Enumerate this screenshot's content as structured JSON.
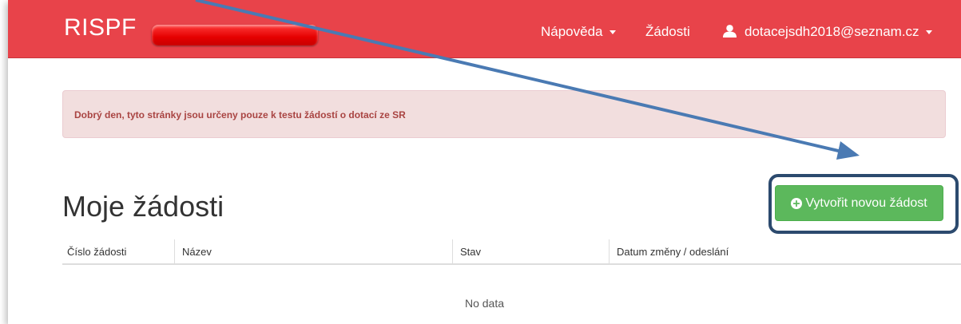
{
  "navbar": {
    "brand": "RISPF",
    "help_label": "Nápověda",
    "requests_label": "Žádosti",
    "user_email": "dotacejsdh2018@seznam.cz"
  },
  "alert": {
    "message": "Dobrý den, tyto stránky jsou určeny pouze k testu žádostí o dotací ze SR"
  },
  "page": {
    "title": "Moje žádosti",
    "create_button_label": "Vytvořit novou žádost"
  },
  "table": {
    "columns": [
      "Číslo žádosti",
      "Název",
      "Stav",
      "Datum změny / odeslání"
    ],
    "empty_text": "No data"
  },
  "colors": {
    "navbar": "#e8434a",
    "button": "#5cb85c",
    "alert_bg": "#f2dede",
    "annotation": "#2c4a6e"
  }
}
